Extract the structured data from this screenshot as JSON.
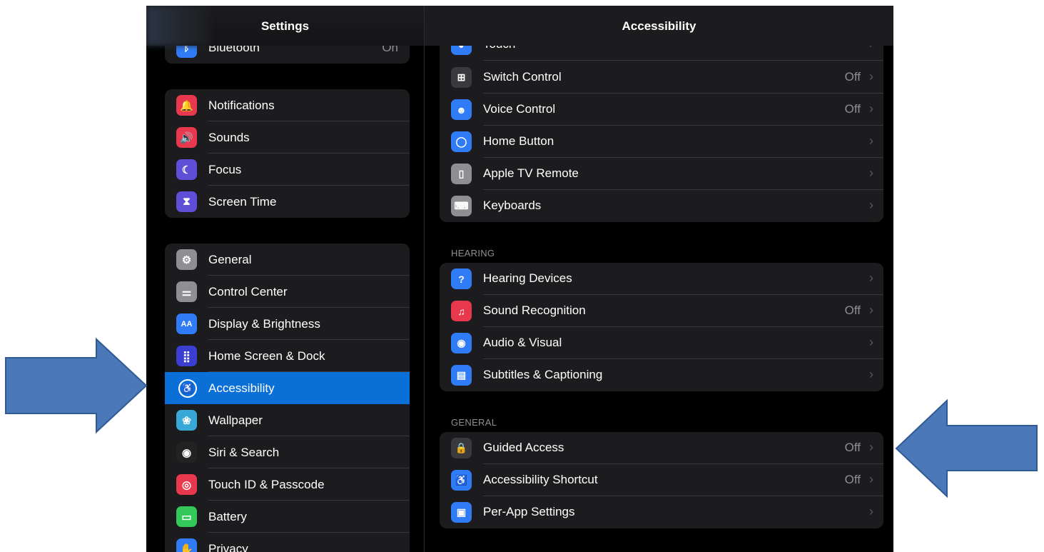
{
  "sidebar": {
    "title": "Settings",
    "top_item": {
      "label": "Bluetooth",
      "value": "On"
    },
    "group1": [
      {
        "label": "Notifications",
        "color": "#e8384d",
        "icon": "bell-icon",
        "glyph": "🔔"
      },
      {
        "label": "Sounds",
        "color": "#e8384d",
        "icon": "speaker-icon",
        "glyph": "🔊"
      },
      {
        "label": "Focus",
        "color": "#5e4fd6",
        "icon": "moon-icon",
        "glyph": "☾"
      },
      {
        "label": "Screen Time",
        "color": "#5e4fd6",
        "icon": "hourglass-icon",
        "glyph": "⧗"
      }
    ],
    "group2": [
      {
        "label": "General",
        "color": "#8e8e93",
        "icon": "gear-icon",
        "glyph": "⚙"
      },
      {
        "label": "Control Center",
        "color": "#8e8e93",
        "icon": "toggles-icon",
        "glyph": "⚌"
      },
      {
        "label": "Display & Brightness",
        "color": "#2f7cf6",
        "icon": "text-size-icon",
        "glyph": "AA"
      },
      {
        "label": "Home Screen & Dock",
        "color": "#3b3fcf",
        "icon": "home-grid-icon",
        "glyph": "⣿"
      },
      {
        "label": "Accessibility",
        "color": "#0a6fd6",
        "icon": "accessibility-icon",
        "glyph": "♿"
      },
      {
        "label": "Wallpaper",
        "color": "#38a8d6",
        "icon": "flower-icon",
        "glyph": "❀"
      },
      {
        "label": "Siri & Search",
        "color": "#222",
        "icon": "siri-icon",
        "glyph": "◉"
      },
      {
        "label": "Touch ID & Passcode",
        "color": "#e8384d",
        "icon": "fingerprint-icon",
        "glyph": "◎"
      },
      {
        "label": "Battery",
        "color": "#34c759",
        "icon": "battery-icon",
        "glyph": "▭"
      },
      {
        "label": "Privacy",
        "color": "#2f7cf6",
        "icon": "hand-icon",
        "glyph": "✋"
      }
    ]
  },
  "content": {
    "title": "Accessibility",
    "top_partial": {
      "label": "Touch"
    },
    "group_physical": [
      {
        "label": "Switch Control",
        "value": "Off",
        "color": "#3a3a3c",
        "icon": "switch-grid-icon",
        "glyph": "⊞"
      },
      {
        "label": "Voice Control",
        "value": "Off",
        "color": "#2f7cf6",
        "icon": "voice-control-icon",
        "glyph": "☻"
      },
      {
        "label": "Home Button",
        "value": "",
        "color": "#2f7cf6",
        "icon": "home-button-icon",
        "glyph": "◯"
      },
      {
        "label": "Apple TV Remote",
        "value": "",
        "color": "#8e8e93",
        "icon": "remote-icon",
        "glyph": "▯"
      },
      {
        "label": "Keyboards",
        "value": "",
        "color": "#8e8e93",
        "icon": "keyboard-icon",
        "glyph": "⌨"
      }
    ],
    "hearing_label": "HEARING",
    "group_hearing": [
      {
        "label": "Hearing Devices",
        "value": "",
        "color": "#2f7cf6",
        "icon": "ear-icon",
        "glyph": "?"
      },
      {
        "label": "Sound Recognition",
        "value": "Off",
        "color": "#e8384d",
        "icon": "sound-wave-icon",
        "glyph": "♫"
      },
      {
        "label": "Audio & Visual",
        "value": "",
        "color": "#2f7cf6",
        "icon": "audio-visual-icon",
        "glyph": "◉"
      },
      {
        "label": "Subtitles & Captioning",
        "value": "",
        "color": "#2f7cf6",
        "icon": "captions-icon",
        "glyph": "▤"
      }
    ],
    "general_label": "GENERAL",
    "group_general": [
      {
        "label": "Guided Access",
        "value": "Off",
        "color": "#3a3a3c",
        "icon": "lock-icon",
        "glyph": "🔒"
      },
      {
        "label": "Accessibility Shortcut",
        "value": "Off",
        "color": "#2f7cf6",
        "icon": "accessibility-shortcut-icon",
        "glyph": "♿"
      },
      {
        "label": "Per-App Settings",
        "value": "",
        "color": "#2f7cf6",
        "icon": "per-app-icon",
        "glyph": "▣"
      }
    ],
    "chevron": "›"
  },
  "annotations": {
    "arrow_color": "#4a78b8"
  }
}
